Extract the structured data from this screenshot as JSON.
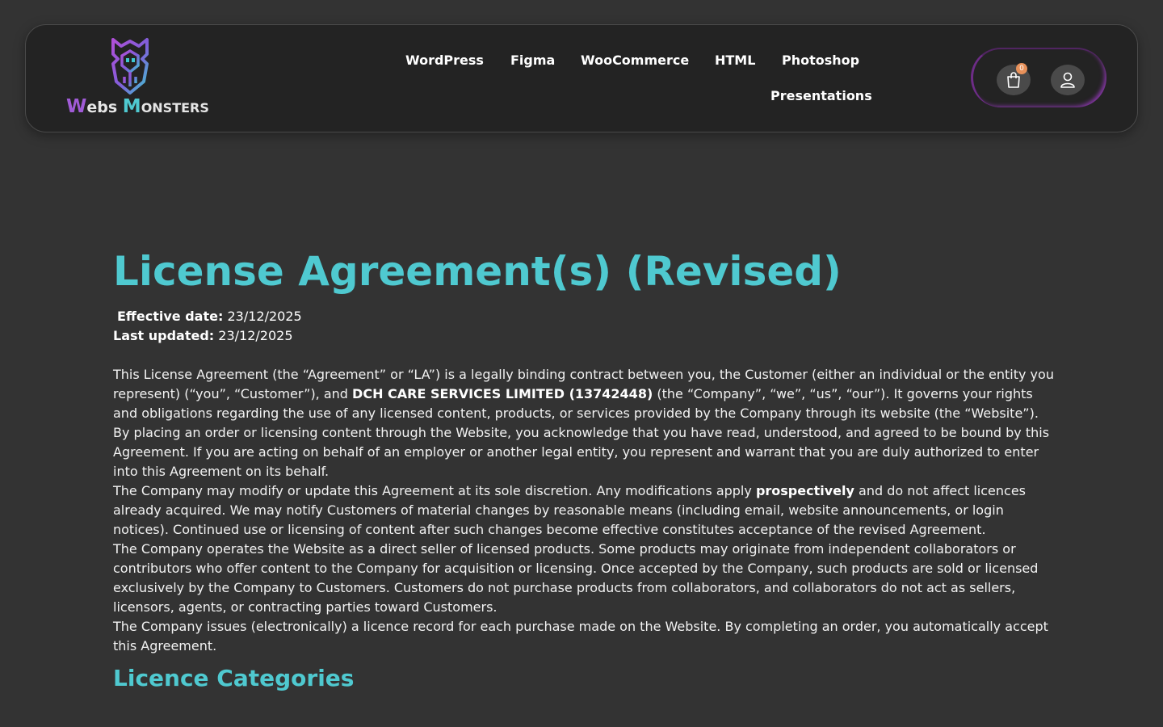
{
  "brand": {
    "name_initial_1": "W",
    "name_rest_1": "ebs",
    "name_initial_2": "M",
    "name_rest_2": "ONSTERS",
    "logo_icon": "monster-shield-icon",
    "colors": {
      "purple": "#a05bd6",
      "teal": "#4fc9d0"
    }
  },
  "nav": {
    "items": [
      "WordPress",
      "Figma",
      "WooCommerce",
      "HTML",
      "Photoshop",
      "Presentations"
    ]
  },
  "header_actions": {
    "cart_icon": "shopping-bag-icon",
    "cart_count": "0",
    "account_icon": "user-icon"
  },
  "page": {
    "title": "License Agreement(s) (Revised)",
    "effective_label": "Effective date:",
    "effective_value": "23/12/2025",
    "updated_label": "Last updated:",
    "updated_value": "23/12/2025",
    "p1_a": "This License Agreement (the “Agreement” or “LA”) is a legally binding contract between you, the Customer (either an individual or the entity you represent) (“you”, “Customer”), and ",
    "p1_bold": "DCH CARE SERVICES LIMITED (13742448)",
    "p1_b": " (the “Company”, “we”, “us”, “our”). It governs your rights and obligations regarding the use of any licensed content, products, or services provided by the Company through its website (the “Website”).",
    "p2": "By placing an order or licensing content through the Website, you acknowledge that you have read, understood, and agreed to be bound by this Agreement. If you are acting on behalf of an employer or another legal entity, you represent and warrant that you are duly authorized to enter into this Agreement on its behalf.",
    "p3_a": "The Company may modify or update this Agreement at its sole discretion. Any modifications apply ",
    "p3_bold": "prospectively",
    "p3_b": " and do not affect licences already acquired. We may notify Customers of material changes by reasonable means (including email, website announcements, or login notices). Continued use or licensing of content after such changes become effective constitutes acceptance of the revised Agreement.",
    "p4": "The Company operates the Website as a direct seller of licensed products. Some products may originate from independent collaborators or contributors who offer content to the Company for acquisition or licensing. Once accepted by the Company, such products are sold or licensed exclusively by the Company to Customers. Customers do not purchase products from collaborators, and collaborators do not act as sellers, licensors, agents, or contracting parties toward Customers.",
    "p5": "The Company issues (electronically) a licence record for each purchase made on the Website. By completing an order, you automatically accept this Agreement.",
    "section_title": "Licence Categories"
  }
}
